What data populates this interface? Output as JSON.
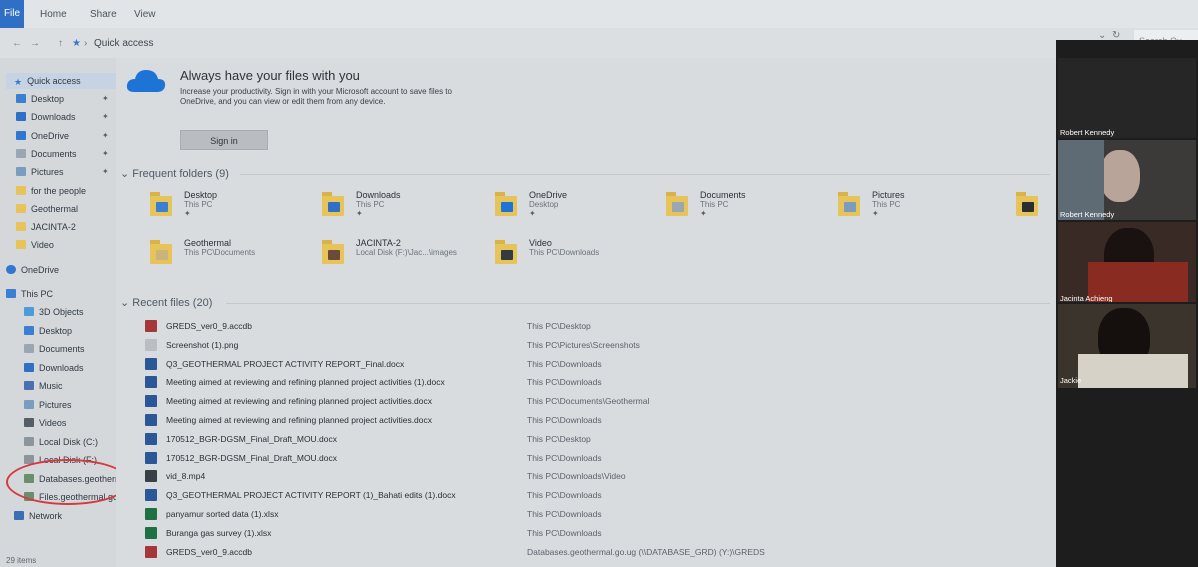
{
  "ribbon": {
    "tabs": [
      "File",
      "Home",
      "Share",
      "View"
    ]
  },
  "address": {
    "path": [
      "Quick access"
    ],
    "search_placeholder": "Search Qu..."
  },
  "nav": {
    "quick_access": "Quick access",
    "quick_items": [
      {
        "label": "Desktop",
        "icon": "desktop-icon",
        "pinned": true
      },
      {
        "label": "Downloads",
        "icon": "download-icon",
        "pinned": true
      },
      {
        "label": "OneDrive",
        "icon": "cloud-icon",
        "pinned": true
      },
      {
        "label": "Documents",
        "icon": "documents-icon",
        "pinned": true
      },
      {
        "label": "Pictures",
        "icon": "pictures-icon",
        "pinned": true
      },
      {
        "label": "for the people",
        "icon": "folder-icon",
        "pinned": false
      },
      {
        "label": "Geothermal",
        "icon": "folder-icon",
        "pinned": false
      },
      {
        "label": "JACINTA-2",
        "icon": "folder-icon",
        "pinned": false
      },
      {
        "label": "Video",
        "icon": "folder-icon",
        "pinned": false
      }
    ],
    "onedrive": "OneDrive",
    "this_pc": "This PC",
    "pc_items": [
      {
        "label": "3D Objects",
        "icon": "3d-objects-icon"
      },
      {
        "label": "Desktop",
        "icon": "desktop-icon"
      },
      {
        "label": "Documents",
        "icon": "documents-icon"
      },
      {
        "label": "Downloads",
        "icon": "download-icon"
      },
      {
        "label": "Music",
        "icon": "music-icon"
      },
      {
        "label": "Pictures",
        "icon": "pictures-icon"
      },
      {
        "label": "Videos",
        "icon": "videos-icon"
      },
      {
        "label": "Local Disk (C:)",
        "icon": "drive-icon"
      },
      {
        "label": "Local Disk (F:)",
        "icon": "drive-icon"
      },
      {
        "label": "Databases.geotherm",
        "icon": "network-drive-icon"
      },
      {
        "label": "Files.geothermal.go",
        "icon": "network-drive-icon"
      }
    ],
    "network": "Network",
    "status": "29 items"
  },
  "onedrive_banner": {
    "title": "Always have your files with you",
    "text": "Increase your productivity. Sign in with your Microsoft account to save files to OneDrive, and you can view or edit them from any device.",
    "button": "Sign in"
  },
  "frequent": {
    "header": "Frequent folders (9)",
    "folders": [
      {
        "name": "Desktop",
        "location": "This PC",
        "pinned": true
      },
      {
        "name": "Downloads",
        "location": "This PC",
        "pinned": true
      },
      {
        "name": "OneDrive",
        "location": "Desktop",
        "pinned": true
      },
      {
        "name": "Documents",
        "location": "This PC",
        "pinned": true
      },
      {
        "name": "Pictures",
        "location": "This PC",
        "pinned": true
      },
      {
        "name": "Geothermal",
        "location": "This PC\\Documents",
        "pinned": false
      },
      {
        "name": "JACINTA-2",
        "location": "Local Disk (F:)\\Jac...\\images",
        "pinned": false
      },
      {
        "name": "Video",
        "location": "This PC\\Downloads",
        "pinned": false
      }
    ]
  },
  "recent": {
    "header": "Recent files (20)",
    "files": [
      {
        "name": "GREDS_ver0_9.accdb",
        "path": "This PC\\Desktop",
        "type": "access"
      },
      {
        "name": "Screenshot (1).png",
        "path": "This PC\\Pictures\\Screenshots",
        "type": "image"
      },
      {
        "name": "Q3_GEOTHERMAL PROJECT ACTIVITY REPORT_Final.docx",
        "path": "This PC\\Downloads",
        "type": "word"
      },
      {
        "name": "Meeting aimed at reviewing and refining planned project activities (1).docx",
        "path": "This PC\\Downloads",
        "type": "word"
      },
      {
        "name": "Meeting aimed at reviewing and refining planned project activities.docx",
        "path": "This PC\\Documents\\Geothermal",
        "type": "word"
      },
      {
        "name": "Meeting aimed at reviewing and refining planned project activities.docx",
        "path": "This PC\\Downloads",
        "type": "word"
      },
      {
        "name": "170512_BGR-DGSM_Final_Draft_MOU.docx",
        "path": "This PC\\Desktop",
        "type": "word"
      },
      {
        "name": "170512_BGR-DGSM_Final_Draft_MOU.docx",
        "path": "This PC\\Downloads",
        "type": "word"
      },
      {
        "name": "vid_8.mp4",
        "path": "This PC\\Downloads\\Video",
        "type": "video"
      },
      {
        "name": "Q3_GEOTHERMAL PROJECT ACTIVITY REPORT (1)_Bahati edits (1).docx",
        "path": "This PC\\Downloads",
        "type": "word"
      },
      {
        "name": "panyamur sorted data (1).xlsx",
        "path": "This PC\\Downloads",
        "type": "excel"
      },
      {
        "name": "Buranga gas survey (1).xlsx",
        "path": "This PC\\Downloads",
        "type": "excel"
      },
      {
        "name": "GREDS_ver0_9.accdb",
        "path": "Databases.geothermal.go.ug (\\\\DATABASE_GRD) (Y:)\\GREDS",
        "type": "access"
      }
    ]
  },
  "zoom": {
    "participants": [
      "Robert Kennedy",
      "Robert Kennedy",
      "Jacinta Achieng",
      "Jackie"
    ]
  },
  "colors": {
    "accent": "#2f6fc6",
    "folder": "#e7c45a",
    "word": "#2b5797",
    "excel": "#1e7145",
    "access": "#a4373a",
    "highlight_circle": "#d6393f"
  }
}
